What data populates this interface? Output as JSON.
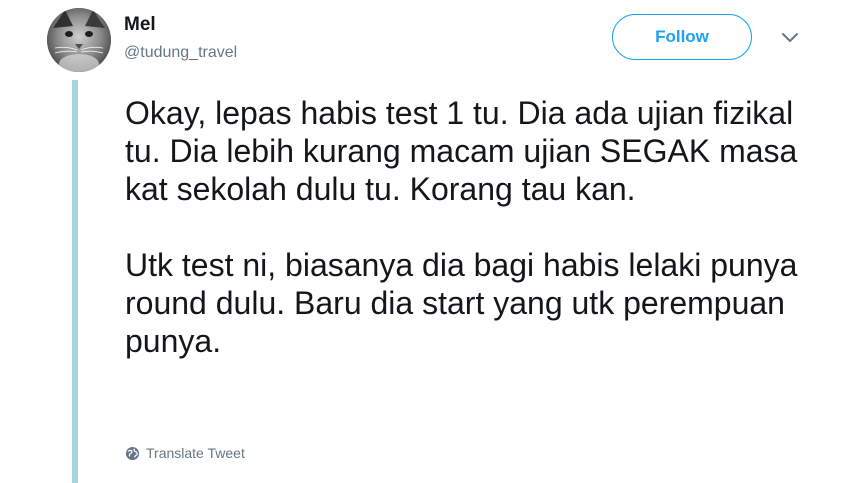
{
  "author": {
    "name": "Mel",
    "handle": "@tudung_travel",
    "avatar_icon": "cat-avatar"
  },
  "actions": {
    "follow_label": "Follow",
    "more_icon": "chevron-down-icon"
  },
  "tweet": {
    "paragraphs": [
      "Okay, lepas habis test 1 tu. Dia ada ujian fizikal tu. Dia lebih kurang macam ujian SEGAK masa kat sekolah dulu tu. Korang tau kan.",
      "Utk test ni, biasanya dia bagi habis lelaki punya round dulu. Baru dia start yang utk perempuan punya."
    ]
  },
  "footer": {
    "translate_label": "Translate Tweet",
    "translate_icon": "globe-icon"
  },
  "colors": {
    "accent": "#1da1f2",
    "thread_line": "#a9d3df",
    "text_primary": "#14171a",
    "text_secondary": "#657786"
  }
}
